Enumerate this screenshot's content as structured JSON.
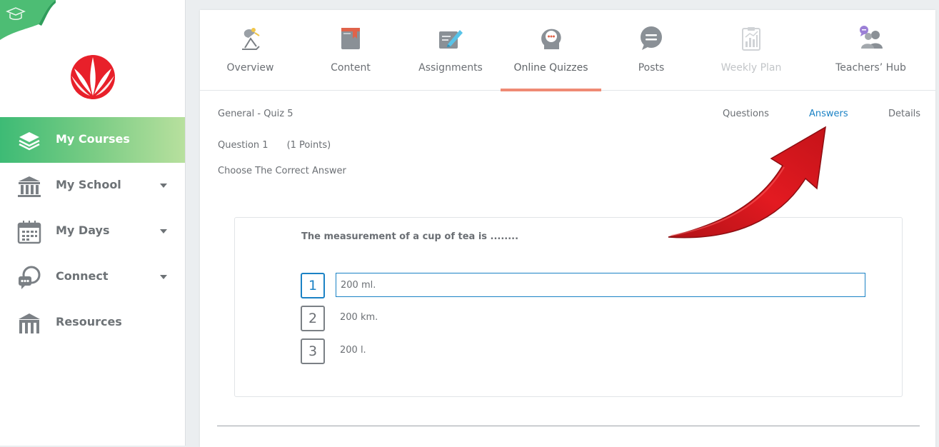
{
  "sidebar": {
    "items": [
      {
        "label": "My Courses",
        "icon": "layers-icon",
        "active": true
      },
      {
        "label": "My School",
        "icon": "building-icon"
      },
      {
        "label": "My Days",
        "icon": "calendar-icon"
      },
      {
        "label": "Connect",
        "icon": "chat-icon"
      },
      {
        "label": "Resources",
        "icon": "library-icon"
      }
    ]
  },
  "tabs": [
    {
      "label": "Overview",
      "icon": "lamp-icon"
    },
    {
      "label": "Content",
      "icon": "book-icon"
    },
    {
      "label": "Assignments",
      "icon": "edit-icon"
    },
    {
      "label": "Online Quizzes",
      "icon": "quiz-head-icon",
      "active": true
    },
    {
      "label": "Posts",
      "icon": "speech-bubble-icon"
    },
    {
      "label": "Weekly Plan",
      "icon": "clipboard-chart-icon",
      "disabled": true
    },
    {
      "label": "Teachers’ Hub",
      "icon": "people-icon"
    }
  ],
  "quiz": {
    "title": "General - Quiz 5",
    "subtabs": {
      "questions": "Questions",
      "answers": "Answers",
      "details": "Details"
    },
    "question_number": "Question 1",
    "points": "(1 Points)",
    "instruction": "Choose The Correct Answer",
    "question_text": "The measurement of a cup of tea is ........",
    "options": [
      {
        "num": "1",
        "text": "200 ml.",
        "selected": true
      },
      {
        "num": "2",
        "text": "200 km."
      },
      {
        "num": "3",
        "text": "200 l."
      }
    ]
  },
  "colors": {
    "accent_green": "#3dbb75",
    "active_tab_underline": "#ef8a74",
    "link_blue": "#1b82c5",
    "logo_red": "#e8202a",
    "arrow_red": "#d9141b"
  }
}
